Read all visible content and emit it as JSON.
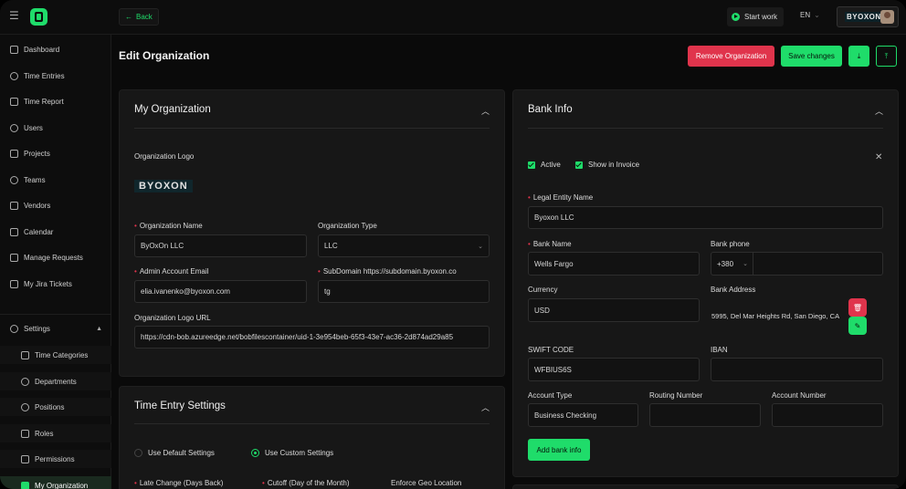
{
  "topbar": {
    "back_label": "Back",
    "start_work_label": "Start work",
    "language": "EN",
    "org_badge": "BYOXON"
  },
  "sidebar": {
    "items": [
      {
        "label": "Dashboard",
        "icon": "grid-icon"
      },
      {
        "label": "Time Entries",
        "icon": "clock-icon"
      },
      {
        "label": "Time Report",
        "icon": "report-icon"
      },
      {
        "label": "Users",
        "icon": "users-icon"
      },
      {
        "label": "Projects",
        "icon": "briefcase-icon"
      },
      {
        "label": "Teams",
        "icon": "team-icon"
      },
      {
        "label": "Vendors",
        "icon": "vendor-icon"
      },
      {
        "label": "Calendar",
        "icon": "calendar-icon"
      },
      {
        "label": "Manage Requests",
        "icon": "inbox-icon"
      },
      {
        "label": "My Jira Tickets",
        "icon": "list-icon"
      }
    ],
    "settings": {
      "label": "Settings",
      "subitems": [
        {
          "label": "Time Categories"
        },
        {
          "label": "Departments"
        },
        {
          "label": "Positions"
        },
        {
          "label": "Roles"
        },
        {
          "label": "Permissions"
        },
        {
          "label": "My Organization"
        }
      ]
    }
  },
  "header": {
    "title": "Edit Organization",
    "remove_label": "Remove Organization",
    "save_label": "Save changes"
  },
  "org_card": {
    "title": "My Organization",
    "logo_label": "Organization Logo",
    "logo_text": "BYOXON",
    "name_label": "Organization Name",
    "name_value": "ByOxOn LLC",
    "type_label": "Organization Type",
    "type_value": "LLC",
    "email_label": "Admin Account Email",
    "email_value": "elia.ivanenko@byoxon.com",
    "subdomain_label": "SubDomain https://subdomain.byoxon.co",
    "subdomain_value": "tg",
    "logo_url_label": "Organization Logo URL",
    "logo_url_value": "https://cdn-bob.azureedge.net/bobfilescontainer/uid-1-3e954beb-65f3-43e7-ac36-2d874ad29a85"
  },
  "time_card": {
    "title": "Time Entry Settings",
    "radio_default": "Use Default Settings",
    "radio_custom": "Use Custom Settings",
    "late_change_label": "Late Change (Days Back)",
    "cutoff_label": "Cutoff (Day of the Month)",
    "geo_label": "Enforce Geo Location"
  },
  "bank_card": {
    "title": "Bank Info",
    "active_label": "Active",
    "show_invoice_label": "Show in Invoice",
    "legal_label": "Legal Entity Name",
    "legal_value": "Byoxon LLC",
    "bank_name_label": "Bank Name",
    "bank_name_value": "Wells Fargo",
    "phone_label": "Bank phone",
    "phone_code": "+380",
    "currency_label": "Currency",
    "currency_value": "USD",
    "address_label": "Bank Address",
    "address_value": "5995, Del Mar Heights Rd, San Diego, CA",
    "swift_label": "SWIFT CODE",
    "swift_value": "WFBIUS6S",
    "iban_label": "IBAN",
    "account_type_label": "Account Type",
    "account_type_value": "Business Checking",
    "routing_label": "Routing Number",
    "account_number_label": "Account Number",
    "add_bank_label": "Add bank info"
  },
  "colors": {
    "accent": "#1fdc6a",
    "danger": "#e0344c",
    "background": "#0a0a0a",
    "card": "#171717"
  }
}
